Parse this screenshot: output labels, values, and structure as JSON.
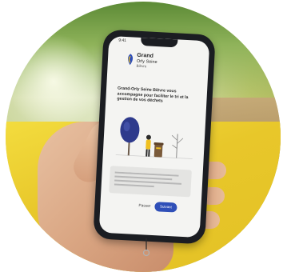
{
  "scene": {
    "accent_colors": {
      "phone_body": "#1b1d22",
      "button_primary": "#2f4fb8",
      "background_yellow": "#e8c72a"
    }
  },
  "phone": {
    "status_time": "9:41",
    "logo": {
      "line1": "Grand",
      "line2": "Orly Seine",
      "line3": "Bièvre"
    },
    "headline": "Grand-Orly Seine Bièvre vous accompagne pour faciliter le tri et la gestion de vos déchets",
    "card_text": "",
    "buttons": {
      "skip": "Passer",
      "next": "Suivant"
    },
    "icons": [
      "tree-icon",
      "person-icon",
      "trash-bin-icon",
      "bare-tree-icon"
    ]
  }
}
